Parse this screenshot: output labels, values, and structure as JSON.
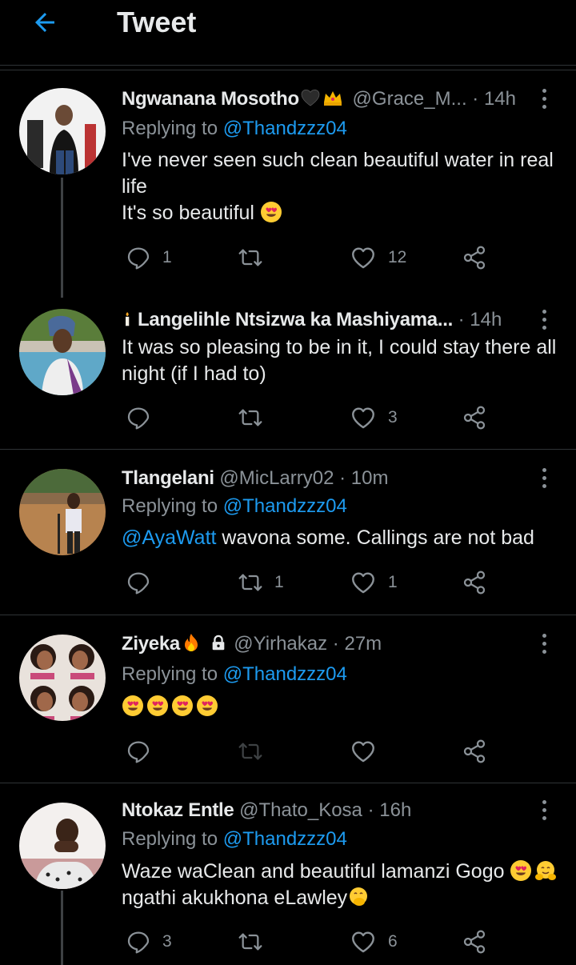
{
  "header": {
    "title": "Tweet"
  },
  "reply_prefix": "Replying to",
  "tweets": [
    {
      "name": "Ngwanana Mosotho",
      "handle": "@Grace_M...",
      "time": "14h",
      "replying_to": "@Thandzzz04",
      "lines": [
        "I've never seen such clean beautiful water in real",
        "life",
        "It's so beautiful"
      ],
      "reply_count": "1",
      "retweet_count": "",
      "like_count": "12"
    },
    {
      "name": "Langelihle Ntsizwa ka Mashiyama...",
      "handle": "",
      "time": "14h",
      "lines": [
        "It was so pleasing to be in it, I could stay there all",
        "night (if I had to)"
      ],
      "reply_count": "",
      "retweet_count": "",
      "like_count": "3"
    },
    {
      "name": "Tlangelani",
      "handle": "@MicLarry02",
      "time": "10m",
      "replying_to": "@Thandzzz04",
      "mention": "@AyaWatt",
      "lines": [
        " wavona some. Callings are not bad"
      ],
      "reply_count": "",
      "retweet_count": "1",
      "like_count": "1"
    },
    {
      "name": "Ziyeka",
      "handle": "@Yirhakaz",
      "time": "27m",
      "replying_to": "@Thandzzz04",
      "reply_count": "",
      "retweet_count": "",
      "like_count": ""
    },
    {
      "name": "Ntokaz Entle",
      "handle": "@Thato_Kosa",
      "time": "16h",
      "replying_to": "@Thandzzz04",
      "lines": [
        "Waze waClean and beautiful lamanzi Gogo",
        "ngathi akukhona eLawley"
      ],
      "reply_count": "3",
      "retweet_count": "",
      "like_count": "6"
    }
  ],
  "dot": "·",
  "colors": {
    "background": "#000000",
    "accent": "#1d9bf0",
    "muted": "#8b9298",
    "text": "#e7e9ea"
  },
  "icons": [
    "back-arrow-icon",
    "more-icon",
    "reply-icon",
    "retweet-icon",
    "like-icon",
    "share-icon",
    "heart-eyes-emoji",
    "crown-emoji",
    "black-heart-emoji",
    "candle-emoji",
    "fire-emoji",
    "lock-icon",
    "hugging-emoji",
    "hand-over-mouth-emoji"
  ]
}
